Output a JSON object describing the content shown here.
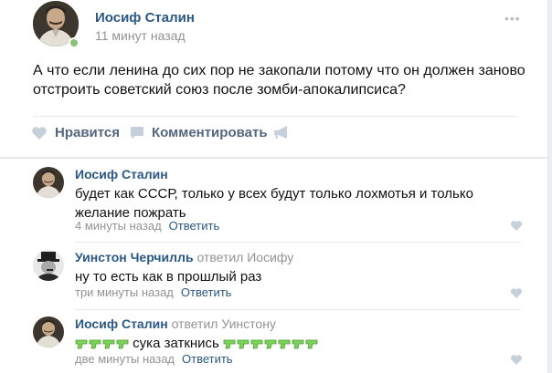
{
  "post": {
    "author": "Иосиф Сталин",
    "time": "11 минут назад",
    "text": "А что если ленина до сих пор не закопали потому что он должен заново отстроить советский союз после зомби-апокалипсиса?",
    "actions": {
      "like_label": "Нравится",
      "comment_label": "Комментировать"
    }
  },
  "comments": [
    {
      "author": "Иосиф Сталин",
      "reply_to": "",
      "text": "будет как СССР, только у всех будут только лохмотья и только желание пожрать",
      "time": "4 минуты назад",
      "reply_label": "Ответить"
    },
    {
      "author": "Уинстон Черчилль",
      "reply_to": "ответил Иосифу",
      "text": "ну то есть как в прошлый раз",
      "time": "три минуты назад",
      "reply_label": "Ответить"
    },
    {
      "author": "Иосиф Сталин",
      "reply_to": "ответил Уинстону",
      "text": "сука заткнись",
      "emoji_before": 4,
      "emoji_after": 7,
      "time": "две минуты назад",
      "reply_label": "Ответить"
    }
  ],
  "colors": {
    "link": "#2a5885",
    "muted": "#939393",
    "action": "#55677d",
    "icon": "#c5d0db",
    "online": "#8ac176",
    "pistol": "#7bd35a"
  },
  "icons": [
    "more-icon",
    "heart-icon",
    "comment-icon",
    "share-icon",
    "water-pistol-emoji"
  ]
}
